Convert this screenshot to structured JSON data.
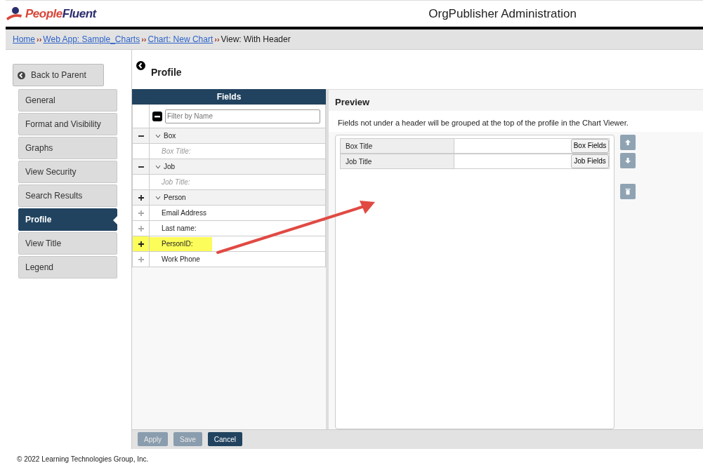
{
  "header": {
    "brand": "PeopleFluent",
    "title": "OrgPublisher Administration"
  },
  "breadcrumb": {
    "links": [
      "Home",
      "Web App: Sample_Charts",
      "Chart: New Chart"
    ],
    "separator": "››",
    "current": "View: With Header"
  },
  "sidebar": {
    "back": "Back to Parent",
    "items": [
      {
        "label": "General",
        "selected": false
      },
      {
        "label": "Format and Visibility",
        "selected": false
      },
      {
        "label": "Graphs",
        "selected": false
      },
      {
        "label": "View Security",
        "selected": false
      },
      {
        "label": "Search Results",
        "selected": false
      },
      {
        "label": "Profile",
        "selected": true
      },
      {
        "label": "View Title",
        "selected": false
      },
      {
        "label": "Legend",
        "selected": false
      }
    ]
  },
  "page_title": "Profile",
  "fields": {
    "title": "Fields",
    "filter_placeholder": "Filter by Name",
    "groups": [
      {
        "label": "Box",
        "kind": "remove",
        "expanded": true,
        "children": [
          {
            "label": "Box Title:",
            "kind": "used",
            "highlighted": false
          }
        ]
      },
      {
        "label": "Job",
        "kind": "remove",
        "expanded": true,
        "children": [
          {
            "label": "Job Title:",
            "kind": "used",
            "highlighted": false
          }
        ]
      },
      {
        "label": "Person",
        "kind": "add",
        "expanded": true,
        "children": [
          {
            "label": "Email Address",
            "kind": "available",
            "highlighted": false
          },
          {
            "label": "Last name:",
            "kind": "available",
            "highlighted": false
          },
          {
            "label": "PersonID:",
            "kind": "available",
            "highlighted": true
          },
          {
            "label": "Work Phone",
            "kind": "available",
            "highlighted": false
          }
        ]
      }
    ]
  },
  "preview": {
    "title": "Preview",
    "note": "Fields not under a header will be grouped at the top of the profile in the Chart Viewer.",
    "rows": [
      {
        "label": "Box Title",
        "button": "Box Fields"
      },
      {
        "label": "Job Title",
        "button": "Job Fields"
      }
    ]
  },
  "buttons": [
    {
      "label": "Apply",
      "disabled": true
    },
    {
      "label": "Save",
      "disabled": true
    },
    {
      "label": "Cancel",
      "disabled": false
    }
  ],
  "footer": "© 2022 Learning Technologies Group, Inc."
}
